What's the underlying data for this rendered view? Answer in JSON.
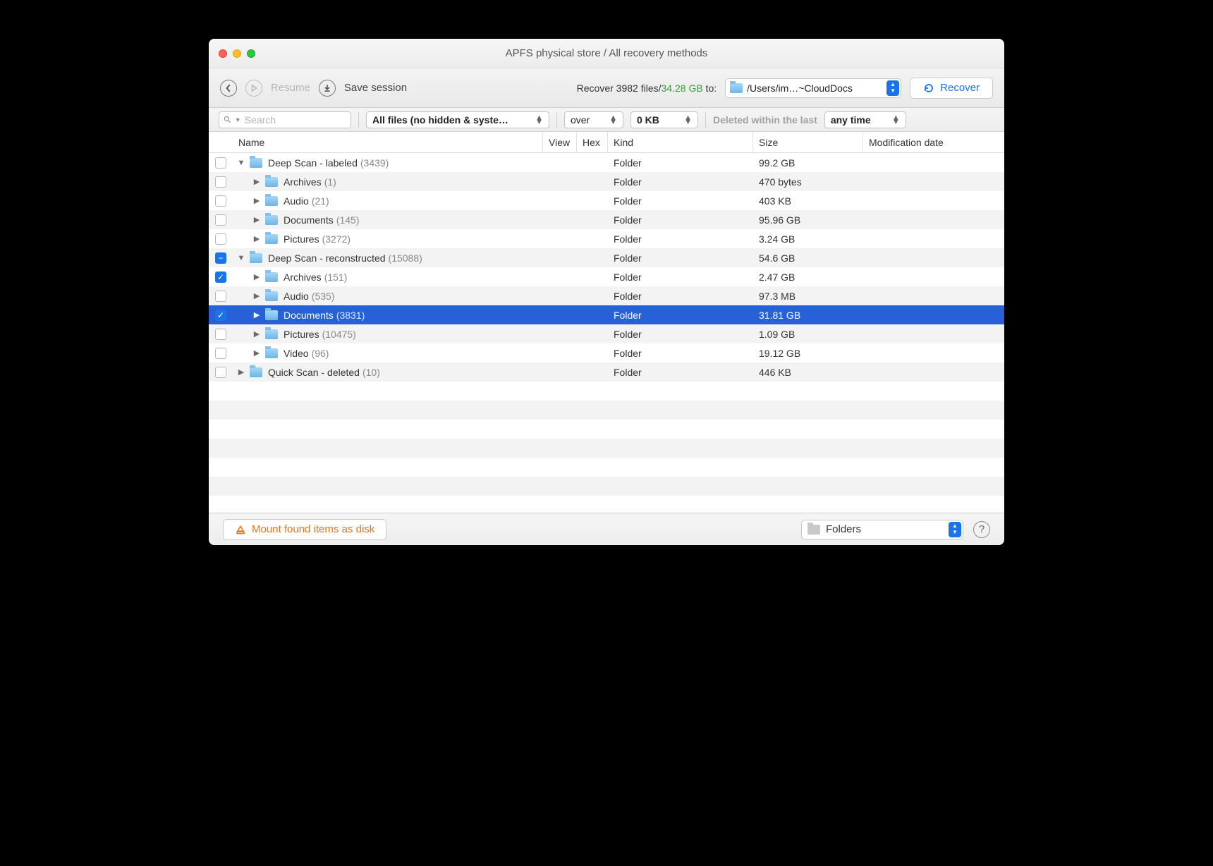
{
  "window": {
    "title": "APFS physical store / All recovery methods"
  },
  "toolbar": {
    "resume_label": "Resume",
    "save_session_label": "Save session",
    "recover_prefix": "Recover ",
    "recover_count": "3982",
    "recover_mid": " files/",
    "recover_size": "34.28 GB",
    "recover_suffix": " to:",
    "destination": "/Users/im…~CloudDocs",
    "recover_button": "Recover"
  },
  "filters": {
    "search_placeholder": "Search",
    "file_filter": "All files (no hidden & syste…",
    "comparator": "over",
    "size_value": "0 KB",
    "deleted_label": "Deleted within the last",
    "time_filter": "any time"
  },
  "columns": {
    "name": "Name",
    "view": "View",
    "hex": "Hex",
    "kind": "Kind",
    "size": "Size",
    "mod": "Modification date"
  },
  "rows": [
    {
      "indent": 0,
      "expanded": true,
      "check": "none",
      "label": "Deep Scan - labeled",
      "count": "(3439)",
      "kind": "Folder",
      "size": "99.2 GB"
    },
    {
      "indent": 1,
      "expanded": false,
      "check": "none",
      "label": "Archives",
      "count": "(1)",
      "kind": "Folder",
      "size": "470 bytes"
    },
    {
      "indent": 1,
      "expanded": false,
      "check": "none",
      "label": "Audio",
      "count": "(21)",
      "kind": "Folder",
      "size": "403 KB"
    },
    {
      "indent": 1,
      "expanded": false,
      "check": "none",
      "label": "Documents",
      "count": "(145)",
      "kind": "Folder",
      "size": "95.96 GB"
    },
    {
      "indent": 1,
      "expanded": false,
      "check": "none",
      "label": "Pictures",
      "count": "(3272)",
      "kind": "Folder",
      "size": "3.24 GB"
    },
    {
      "indent": 0,
      "expanded": true,
      "check": "partial",
      "label": "Deep Scan - reconstructed",
      "count": "(15088)",
      "kind": "Folder",
      "size": "54.6 GB"
    },
    {
      "indent": 1,
      "expanded": false,
      "check": "checked",
      "label": "Archives",
      "count": "(151)",
      "kind": "Folder",
      "size": "2.47 GB"
    },
    {
      "indent": 1,
      "expanded": false,
      "check": "none",
      "label": "Audio",
      "count": "(535)",
      "kind": "Folder",
      "size": "97.3 MB"
    },
    {
      "indent": 1,
      "expanded": false,
      "check": "checked",
      "label": "Documents",
      "count": "(3831)",
      "kind": "Folder",
      "size": "31.81 GB",
      "selected": true
    },
    {
      "indent": 1,
      "expanded": false,
      "check": "none",
      "label": "Pictures",
      "count": "(10475)",
      "kind": "Folder",
      "size": "1.09 GB"
    },
    {
      "indent": 1,
      "expanded": false,
      "check": "none",
      "label": "Video",
      "count": "(96)",
      "kind": "Folder",
      "size": "19.12 GB"
    },
    {
      "indent": 0,
      "expanded": false,
      "check": "none",
      "label": "Quick Scan - deleted",
      "count": "(10)",
      "kind": "Folder",
      "size": "446 KB"
    }
  ],
  "footer": {
    "mount_label": "Mount found items as disk",
    "view_mode": "Folders"
  }
}
